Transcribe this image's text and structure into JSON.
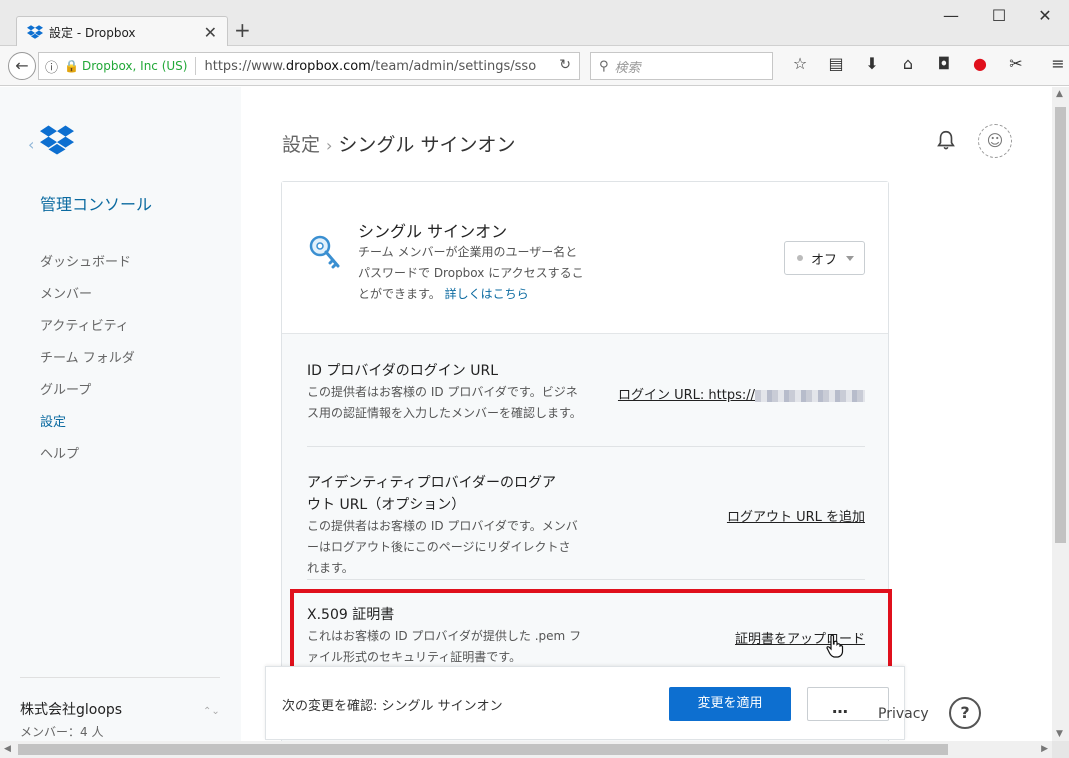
{
  "window": {
    "tab_title": "設定 - Dropbox",
    "tab_close": "✕",
    "new_tab": "+",
    "minimize": "—",
    "maximize": "☐",
    "close": "✕"
  },
  "browser": {
    "back": "←",
    "info": "ⓘ",
    "lock": "🔒",
    "org": "Dropbox, Inc (US)",
    "url_prefix": "https://www.",
    "url_host": "dropbox.com",
    "url_path": "/team/admin/settings/sso",
    "reload": "↻",
    "search_placeholder": "検索",
    "search_icon": "⚲",
    "toolbar": [
      "☆",
      "▤",
      "⬇",
      "⌂",
      "◘",
      "●",
      "✂",
      "≡"
    ]
  },
  "sidebar": {
    "back": "‹",
    "title": "管理コンソール",
    "items": [
      "ダッシュボード",
      "メンバー",
      "アクティビティ",
      "チーム フォルダ",
      "グループ",
      "設定",
      "ヘルプ"
    ],
    "active_index": 5,
    "company": "株式会社gloops",
    "members": "メンバー：4 人",
    "updown": "⌃⌄"
  },
  "breadcrumb": {
    "root": "設定",
    "sep": "›",
    "current": "シングル サインオン"
  },
  "header": {
    "avatar": "☺"
  },
  "sso": {
    "title": "シングル サインオン",
    "desc": "チーム メンバーが企業用のユーザー名とパスワードで Dropbox にアクセスすることができます。",
    "link": "詳しくはこちら",
    "dropdown_value": "オフ"
  },
  "rows": {
    "login": {
      "title": "ID プロバイダのログイン URL",
      "desc": "この提供者はお客様の ID プロバイダです。ビジネス用の認証情報を入力したメンバーを確認します。",
      "action": "ログイン URL: https://"
    },
    "logout": {
      "title": "アイデンティティプロバイダーのログアウト URL（オプション）",
      "desc": "この提供者はお客様の ID プロバイダです。メンバーはログアウト後にこのページにリダイレクトされます。",
      "action": "ログアウト URL を追加"
    },
    "cert": {
      "title": "X.509 証明書",
      "desc": "これはお客様の ID プロバイダが提供した .pem ファイル形式のセキュリティ証明書です。",
      "action": "証明書をアップロード"
    }
  },
  "bottom": {
    "confirm": "次の変更を確認: シングル サインオン",
    "apply": "変更を適用",
    "more": "…",
    "privacy": "Privacy",
    "help": "?"
  },
  "colors": {
    "accent": "#0d6fd0",
    "link": "#0b6aa0",
    "highlight": "#e0101c",
    "secure": "#22a838"
  }
}
